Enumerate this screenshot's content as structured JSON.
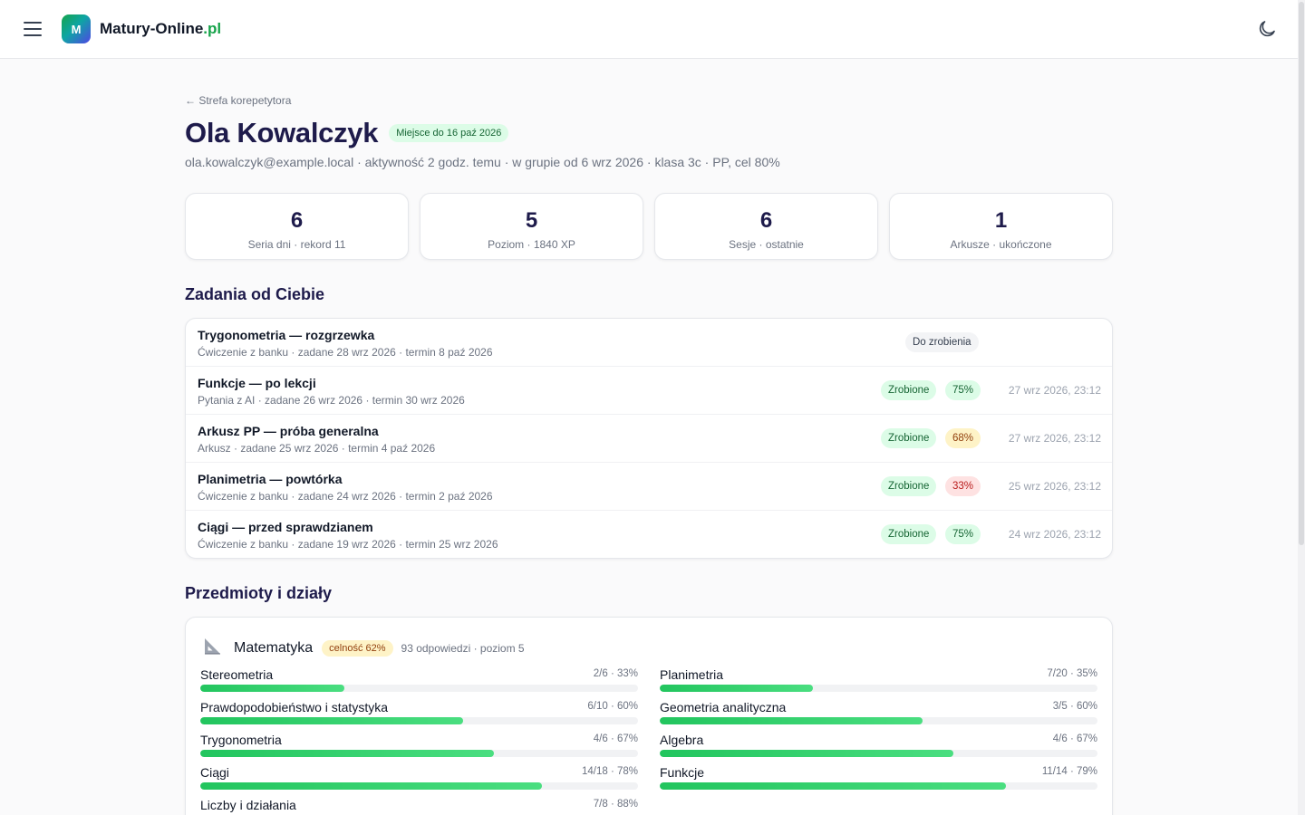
{
  "header": {
    "logo_letter": "M",
    "brand_name": "Matury-Online",
    "brand_tld": ".pl"
  },
  "page": {
    "back_label": "← Strefa korepetytora",
    "student_name": "Ola Kowalczyk",
    "place_badge": "Miejsce do 16 paź 2026",
    "meta": "ola.kowalczyk@example.local · aktywność 2 godz. temu · w grupie od 6 wrz 2026 · klasa 3c · PP, cel 80%"
  },
  "stats": [
    {
      "value": "6",
      "label": "Seria dni · rekord 11"
    },
    {
      "value": "5",
      "label": "Poziom · 1840 XP"
    },
    {
      "value": "6",
      "label": "Sesje · ostatnie"
    },
    {
      "value": "1",
      "label": "Arkusze · ukończone"
    }
  ],
  "assignments_section": {
    "title": "Zadania od Ciebie",
    "rows": [
      {
        "title": "Trygonometria — rozgrzewka",
        "sub": "Ćwiczenie z banku · zadane 28 wrz 2026 · termin 8 paź 2026",
        "status": "Do zrobienia",
        "score": "",
        "score_level": "",
        "date": ""
      },
      {
        "title": "Funkcje — po lekcji",
        "sub": "Pytania z AI · zadane 26 wrz 2026 · termin 30 wrz 2026",
        "status": "Zrobione",
        "score": "75%",
        "score_level": "good",
        "date": "27 wrz 2026, 23:12"
      },
      {
        "title": "Arkusz PP — próba generalna",
        "sub": "Arkusz · zadane 25 wrz 2026 · termin 4 paź 2026",
        "status": "Zrobione",
        "score": "68%",
        "score_level": "mid",
        "date": "27 wrz 2026, 23:12"
      },
      {
        "title": "Planimetria — powtórka",
        "sub": "Ćwiczenie z banku · zadane 24 wrz 2026 · termin 2 paź 2026",
        "status": "Zrobione",
        "score": "33%",
        "score_level": "bad",
        "date": "25 wrz 2026, 23:12"
      },
      {
        "title": "Ciągi — przed sprawdzianem",
        "sub": "Ćwiczenie z banku · zadane 19 wrz 2026 · termin 25 wrz 2026",
        "status": "Zrobione",
        "score": "75%",
        "score_level": "good",
        "date": "24 wrz 2026, 23:12"
      }
    ]
  },
  "subjects_section": {
    "title": "Przedmioty i działy",
    "subject": {
      "icon": "set-square-icon",
      "name": "Matematyka",
      "accuracy": "celność 62%",
      "meta": "93 odpowiedzi · poziom 5",
      "topics": [
        {
          "name": "Stereometria",
          "score": "2/6 · 33%",
          "fraction": 0.33
        },
        {
          "name": "Planimetria",
          "score": "7/20 · 35%",
          "fraction": 0.35
        },
        {
          "name": "Prawdopodobieństwo i statystyka",
          "score": "6/10 · 60%",
          "fraction": 0.6
        },
        {
          "name": "Geometria analityczna",
          "score": "3/5 · 60%",
          "fraction": 0.6
        },
        {
          "name": "Trygonometria",
          "score": "4/6 · 67%",
          "fraction": 0.67
        },
        {
          "name": "Algebra",
          "score": "4/6 · 67%",
          "fraction": 0.67
        },
        {
          "name": "Ciągi",
          "score": "14/18 · 78%",
          "fraction": 0.78
        },
        {
          "name": "Funkcje",
          "score": "11/14 · 79%",
          "fraction": 0.79
        },
        {
          "name": "Liczby i działania",
          "score": "7/8 · 88%",
          "fraction": 0.88
        }
      ]
    }
  },
  "colors": {
    "accent_green": "#16a34a",
    "title_navy": "#1e1b4b",
    "bar_green": "#22c55e"
  }
}
